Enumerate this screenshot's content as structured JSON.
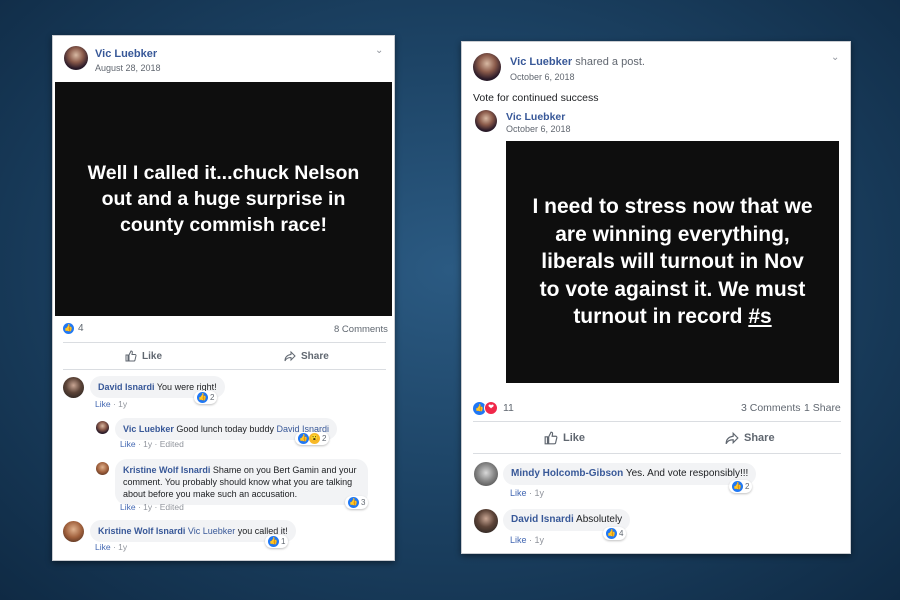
{
  "left_post": {
    "author": "Vic Luebker",
    "date": "August 28, 2018",
    "image_text": "Well I called it...chuck Nelson out and a huge surprise in county commish race!",
    "reactions_count": "4",
    "comments_count": "8 Comments",
    "like_label": "Like",
    "share_label": "Share",
    "comments": [
      {
        "author": "David Isnardi",
        "text": "You were right!",
        "actions": [
          "Like",
          "1y"
        ],
        "reactions": "2"
      },
      {
        "author": "Vic Luebker",
        "text": "Good lunch today buddy ",
        "mention": "David Isnardi",
        "actions": [
          "Like",
          "1y",
          "Edited"
        ],
        "reactions": "2"
      },
      {
        "author": "Kristine Wolf Isnardi",
        "text": "Shame on you Bert Gamin and your comment. You probably should know what you are talking about before you make such an accusation.",
        "actions": [
          "Like",
          "1y",
          "Edited"
        ],
        "reactions": "3"
      },
      {
        "author": "Kristine Wolf Isnardi",
        "mention": "Vic Luebker",
        "text": " you called it!",
        "actions": [
          "Like",
          "1y"
        ],
        "reactions": "1"
      }
    ]
  },
  "right_post": {
    "author": "Vic Luebker",
    "action_text": "shared a post.",
    "date": "October 6, 2018",
    "body": "Vote for continued success",
    "shared_author": "Vic Luebker",
    "shared_date": "October 6, 2018",
    "image_text_before": "I need to stress now that we are winning everything, liberals will turnout in Nov to vote against it. We must turnout in record ",
    "image_text_link": "#s",
    "reactions_count": "11",
    "comments_count": "3 Comments",
    "shares_count": "1 Share",
    "like_label": "Like",
    "share_label": "Share",
    "comments": [
      {
        "author": "Mindy Holcomb-Gibson",
        "text": "Yes. And vote responsibly!!!",
        "actions": [
          "Like",
          "1y"
        ],
        "reactions": "2"
      },
      {
        "author": "David Isnardi",
        "text": "Absolutely",
        "actions": [
          "Like",
          "1y"
        ],
        "reactions": "4"
      }
    ]
  }
}
